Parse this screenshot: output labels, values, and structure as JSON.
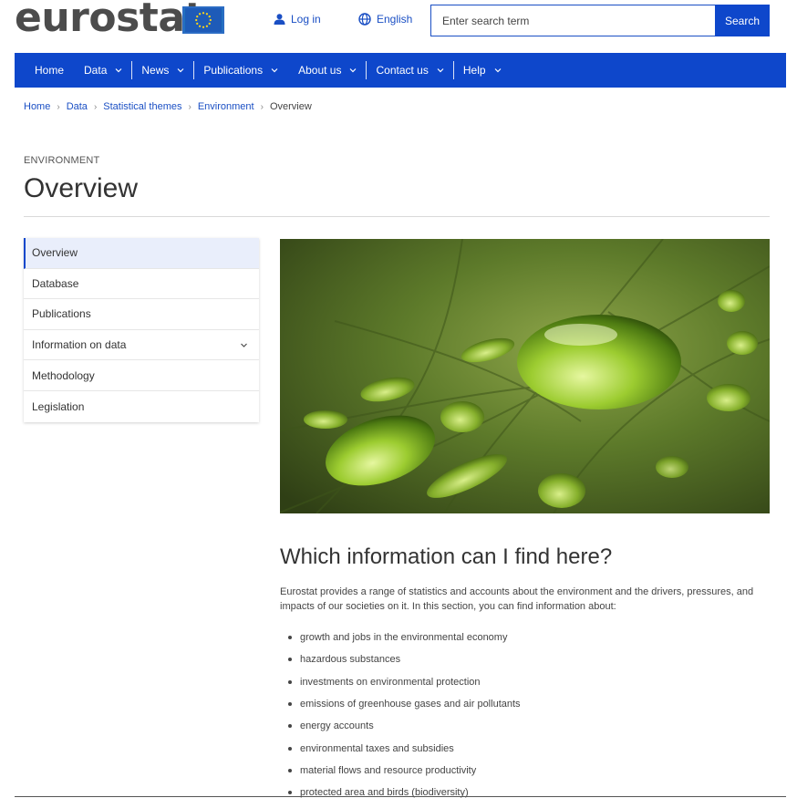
{
  "header": {
    "logo_text": "eurostat",
    "login_label": "Log in",
    "language_label": "English",
    "search_placeholder": "Enter search term",
    "search_button_label": "Search"
  },
  "nav": {
    "items": [
      {
        "label": "Home",
        "has_dropdown": false
      },
      {
        "label": "Data",
        "has_dropdown": true
      },
      {
        "label": "News",
        "has_dropdown": true
      },
      {
        "label": "Publications",
        "has_dropdown": true
      },
      {
        "label": "About us",
        "has_dropdown": true
      },
      {
        "label": "Contact us",
        "has_dropdown": true
      },
      {
        "label": "Help",
        "has_dropdown": true
      }
    ]
  },
  "breadcrumb": [
    "Home",
    "Data",
    "Statistical themes",
    "Environment",
    "Overview"
  ],
  "page": {
    "kicker": "ENVIRONMENT",
    "title": "Overview"
  },
  "sidemenu": {
    "items": [
      {
        "label": "Overview",
        "active": true
      },
      {
        "label": "Database",
        "active": false
      },
      {
        "label": "Publications",
        "active": false
      },
      {
        "label": "Information on data",
        "active": false,
        "expandable": true
      },
      {
        "label": "Methodology",
        "active": false
      },
      {
        "label": "Legislation",
        "active": false
      }
    ]
  },
  "content": {
    "heading": "Which information can I find here?",
    "intro": "Eurostat provides a range of statistics and accounts about the environment and the drivers, pressures, and impacts of our societies on it. In this section, you can find information about:",
    "topics": [
      "growth and jobs in the environmental economy",
      "hazardous substances",
      "investments on environmental protection",
      "emissions of greenhouse gases and air pollutants",
      "energy accounts",
      "environmental taxes and subsidies",
      "material flows and resource productivity",
      "protected area and birds (biodiversity)"
    ]
  },
  "colors": {
    "brand_blue": "#0e47cb",
    "link_blue": "#1a4fc4",
    "logo_grey": "#4c4c4c"
  },
  "icons": {
    "login": "user-icon",
    "language": "globe-icon",
    "nav_dropdown": "chevron-down-icon",
    "breadcrumb_sep": "chevron-right-icon"
  }
}
